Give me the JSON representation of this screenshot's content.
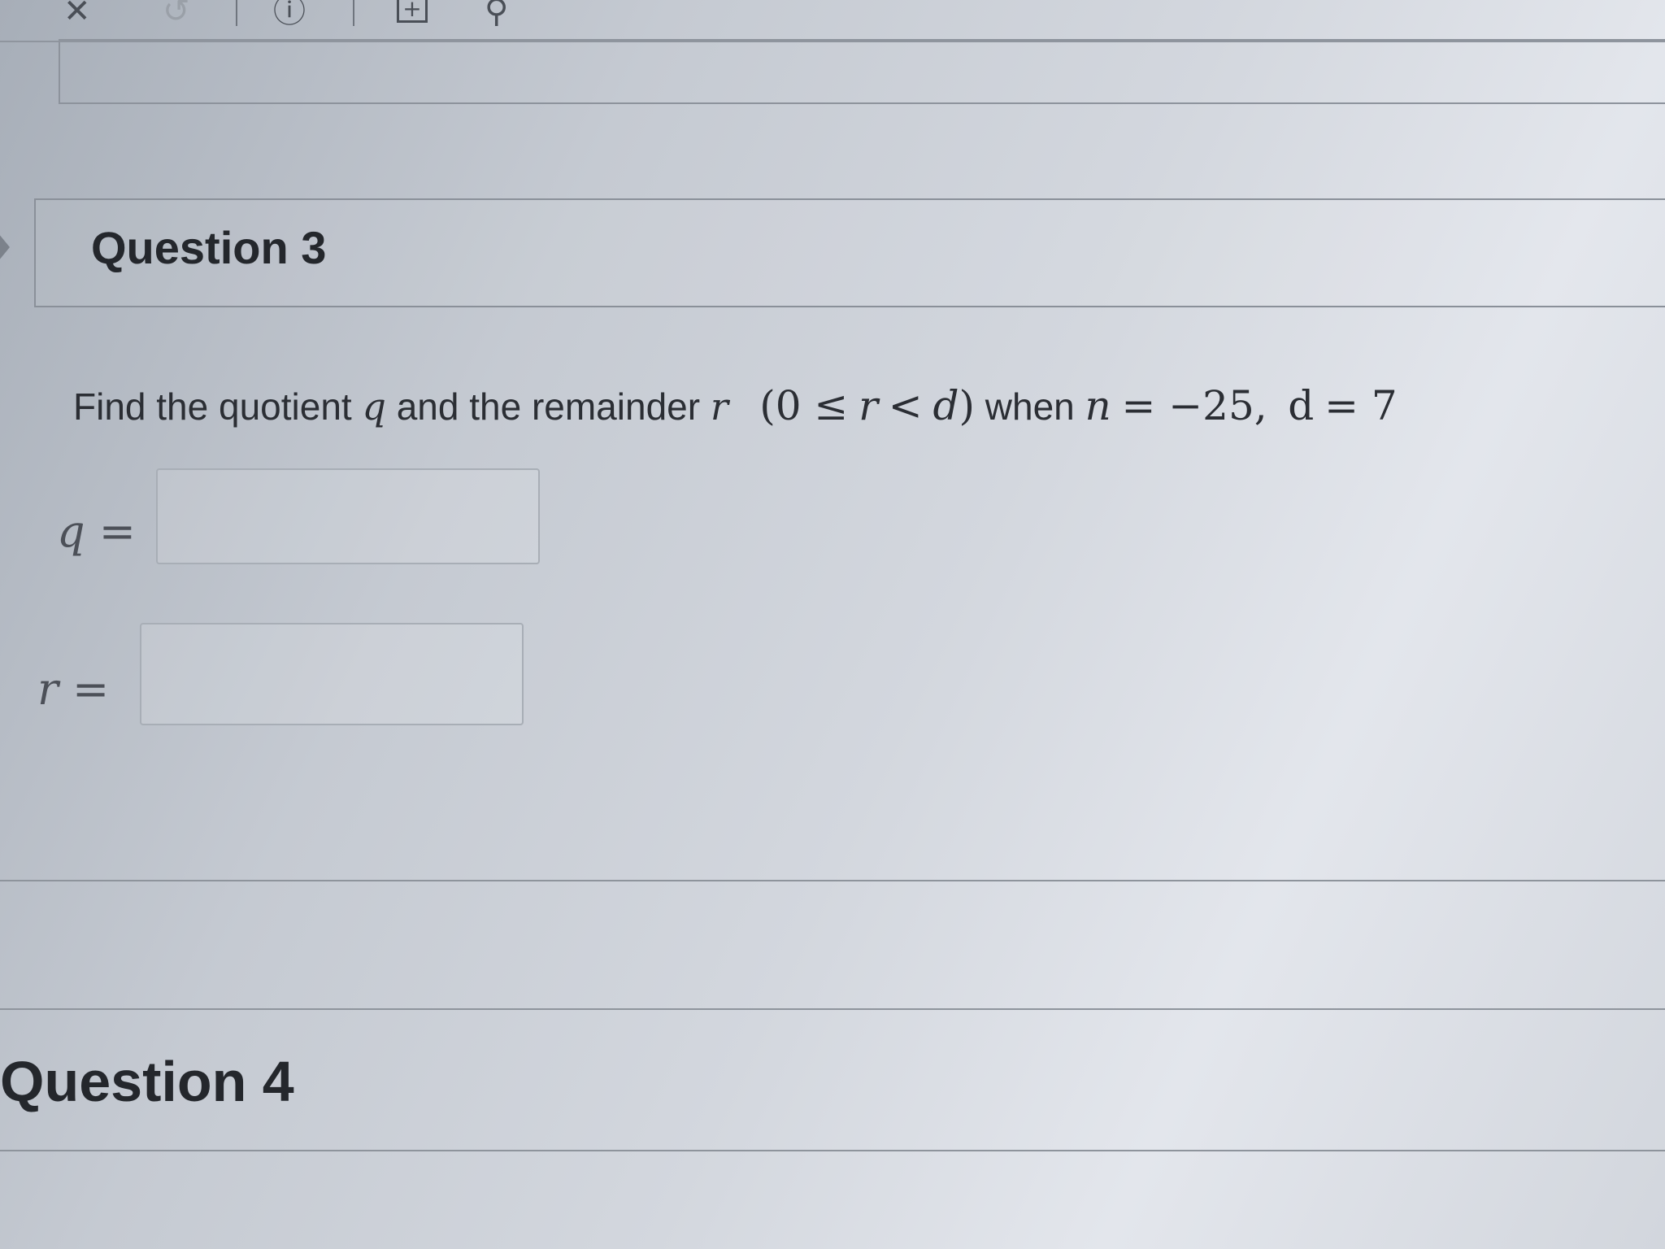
{
  "toolbar": {
    "close_icon": "✕",
    "history_icon": "↺",
    "info_icon": "ⓘ",
    "add_icon": "+",
    "search_icon": "⚲"
  },
  "question3": {
    "heading": "Question 3",
    "prompt": {
      "find_the_quotient": "Find the quotient",
      "q_var": "q",
      "and_the_remainder": "and the remainder",
      "r_var": "r",
      "condition_open": "(0 ≤",
      "condition_r": "r",
      "condition_lt": "<",
      "condition_d": "d",
      "condition_close": ")",
      "when": "when",
      "n_var": "n",
      "n_value": "= −25,",
      "d_var": "d",
      "d_value": "= 7"
    },
    "answers": {
      "q_label_var": "q",
      "q_label_eq": "=",
      "q_value": "",
      "r_label_var": "r",
      "r_label_eq": "=",
      "r_value": ""
    }
  },
  "question4": {
    "heading": "Question 4"
  }
}
